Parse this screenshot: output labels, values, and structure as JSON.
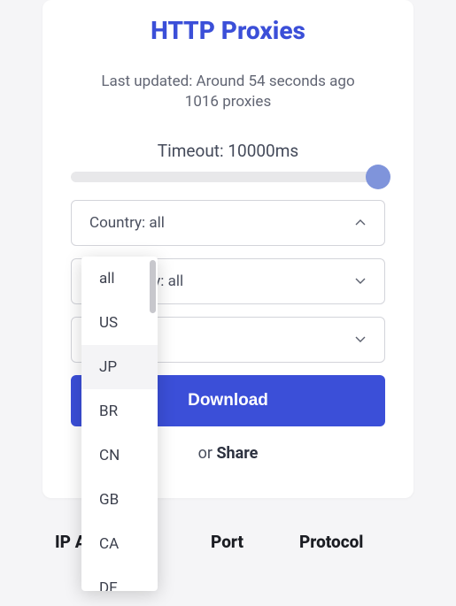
{
  "header": {
    "title": "HTTP Proxies",
    "last_updated": "Last updated: Around 54 seconds ago",
    "proxy_count": "1016 proxies"
  },
  "filters": {
    "timeout_label": "Timeout: 10000ms",
    "timeout_value": 10000,
    "timeout_min": 0,
    "timeout_max": 10000,
    "country": {
      "label": "Country: all",
      "value": "all",
      "expanded": true
    },
    "anonymity": {
      "label": "Anonymity: all",
      "value": "all"
    },
    "third_filter_label": ""
  },
  "country_options": [
    {
      "code": "all",
      "label": "all",
      "hover": false
    },
    {
      "code": "US",
      "label": "US",
      "hover": false
    },
    {
      "code": "JP",
      "label": "JP",
      "hover": true
    },
    {
      "code": "BR",
      "label": "BR",
      "hover": false
    },
    {
      "code": "CN",
      "label": "CN",
      "hover": false
    },
    {
      "code": "GB",
      "label": "GB",
      "hover": false
    },
    {
      "code": "CA",
      "label": "CA",
      "hover": false
    },
    {
      "code": "DE",
      "label": "DE",
      "hover": false
    }
  ],
  "actions": {
    "download_label": "Download",
    "or_label": "or ",
    "share_label": "Share"
  },
  "table": {
    "columns": [
      "IP Address",
      "Port",
      "Protocol"
    ]
  }
}
